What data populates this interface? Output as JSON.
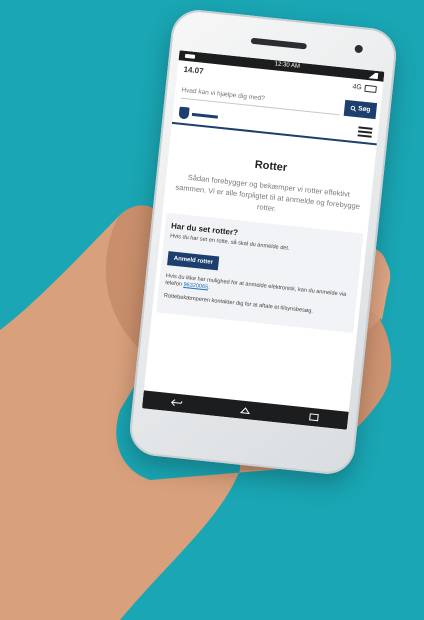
{
  "colors": {
    "background": "#1aa6b4",
    "brand": "#1d3f6e",
    "link": "#1d6fb5"
  },
  "status_bar": {
    "time": "12:30 AM"
  },
  "info_bar": {
    "clock": "14.07",
    "network": "4G"
  },
  "search": {
    "placeholder": "Hvad kan vi hjælpe dig med?",
    "button_label": "Søg",
    "icon": "search-icon"
  },
  "header": {
    "logo_icon": "municipality-crest-icon",
    "menu_icon": "hamburger-menu-icon"
  },
  "page": {
    "title": "Rotter",
    "lead": "Sådan forebygger og bekæmper vi rotter effektivt sammen. Vi er alle forpligtet til at anmelde og forebygge rotter."
  },
  "card": {
    "title": "Har du set rotter?",
    "intro": "Hvis du har set en rotte, så skal du anmelde det.",
    "button_label": "Anmeld rotter",
    "phone_text": "Hvis du ikke har mulighed for at anmelde elektronisk, kan du anmelde via telefon",
    "phone_number": "96320065",
    "phone_suffix": ".",
    "contact_text": "Rottebekæmperen kontakter dig for at aftale et tilsynsbesøg."
  },
  "navbar": {
    "back_icon": "back-icon",
    "home_icon": "home-icon",
    "recents_icon": "recents-icon"
  }
}
